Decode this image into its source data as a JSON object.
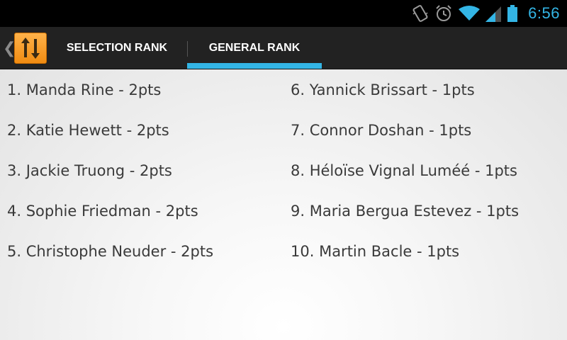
{
  "status_bar": {
    "time": "6:56",
    "icons": [
      "vibrate-icon",
      "alarm-icon",
      "wifi-icon",
      "signal-icon",
      "battery-icon"
    ]
  },
  "action_bar": {
    "app_icon": "sort-arrows-icon",
    "tabs": [
      {
        "label": "SELECTION RANK",
        "selected": false
      },
      {
        "label": "GENERAL RANK",
        "selected": true
      }
    ]
  },
  "ranking": {
    "left_column": [
      "1. Manda Rine -  2pts",
      "2. Katie Hewett -  2pts",
      "3. Jackie Truong -  2pts",
      "4. Sophie Friedman -  2pts",
      "5. Christophe Neuder -  2pts"
    ],
    "right_column": [
      "6. Yannick Brissart -  1pts",
      "7. Connor Doshan -  1pts",
      "8. Héloïse Vignal Luméé -  1pts",
      "9. Maria Bergua Estevez -  1pts",
      "10. Martin Bacle -  1pts"
    ]
  },
  "colors": {
    "accent": "#33b5e5",
    "action_bar": "#222222",
    "app_icon": "#f39c1f"
  }
}
